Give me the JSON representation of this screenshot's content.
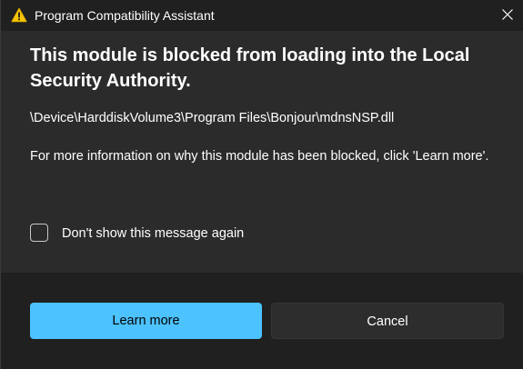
{
  "window": {
    "title": "Program Compatibility Assistant",
    "icon": "warning-icon",
    "close_icon": "close-icon"
  },
  "message": {
    "heading": "This module is blocked from loading into the Local Security Authority.",
    "path": "\\Device\\HarddiskVolume3\\Program Files\\Bonjour\\mdnsNSP.dll",
    "info": "For more information on why this module has been blocked, click 'Learn more'."
  },
  "checkbox": {
    "label": "Don't show this message again",
    "checked": false
  },
  "buttons": {
    "learn_more": "Learn more",
    "cancel": "Cancel"
  },
  "colors": {
    "accent": "#4cc2ff",
    "warning": "#f7c600",
    "background": "#2b2b2b",
    "footer": "#202020"
  }
}
